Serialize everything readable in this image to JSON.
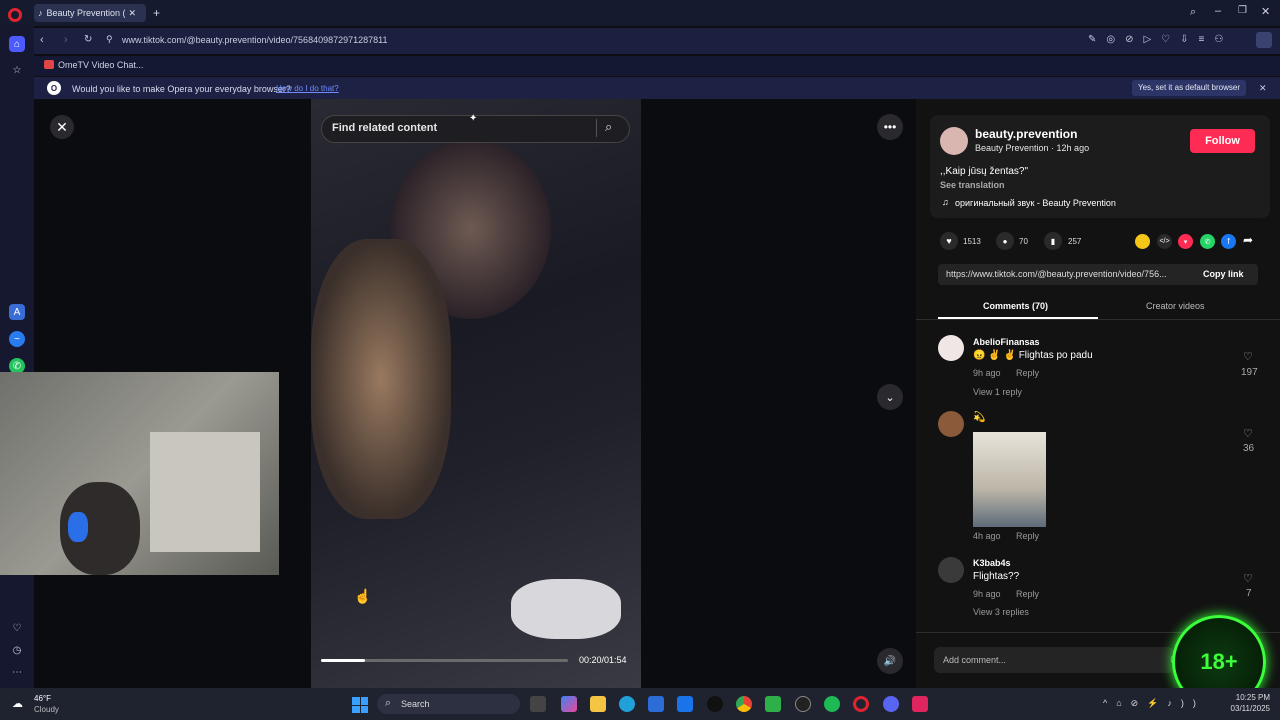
{
  "browser": {
    "tab_title": "Beauty Prevention (@",
    "url": "www.tiktok.com/@beauty.prevention/video/7568409872971287811",
    "bookmark": "OmeTV Video Chat...",
    "default_prompt": "Would you like to make Opera your everyday browser?",
    "default_link": "How do I do that?",
    "default_button": "Yes, set it as default browser"
  },
  "video": {
    "search_placeholder": "Find related content",
    "time": "00:20/01:54",
    "progress": 0.18
  },
  "author": {
    "handle": "beauty.prevention",
    "meta": "Beauty Prevention · 12h ago",
    "follow_label": "Follow",
    "caption": ",,Kaip jūsų žentas?\"",
    "see_translation": "See translation",
    "sound": "оригинальный звук - Beauty Prevention"
  },
  "stats": {
    "likes": "1513",
    "comments": "70",
    "saves": "257"
  },
  "share": {
    "link": "https://www.tiktok.com/@beauty.prevention/video/756...",
    "copy_label": "Copy link"
  },
  "tabs": {
    "comments": "Comments (70)",
    "creator": "Creator videos"
  },
  "comments": [
    {
      "user": "AbelioFinansas",
      "text": "😠 ✌ ✌ Flightas po padu",
      "time": "9h ago",
      "reply": "Reply",
      "likes": "197",
      "view": "View 1 reply"
    },
    {
      "user": "",
      "text": "💫",
      "time": "4h ago",
      "reply": "Reply",
      "likes": "36",
      "view": ""
    },
    {
      "user": "K3bab4s",
      "text": "Flightas??",
      "time": "9h ago",
      "reply": "Reply",
      "likes": "7",
      "view": "View 3 replies"
    }
  ],
  "add_comment": "Add comment...",
  "badge": "18+",
  "taskbar": {
    "weather_temp": "46°F",
    "weather_desc": "Cloudy",
    "search": "Search",
    "time": "10:25 PM",
    "date": "03/11/2025"
  }
}
